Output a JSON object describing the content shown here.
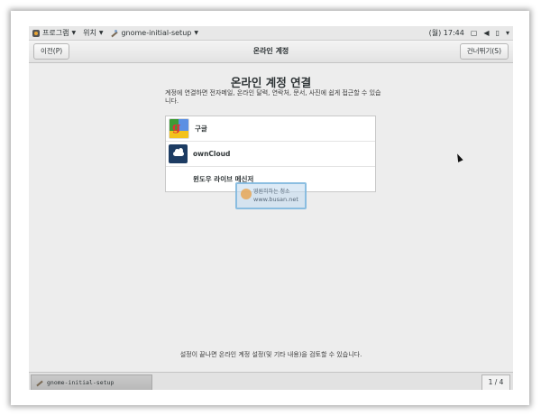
{
  "top_panel": {
    "applications_label": "프로그램",
    "places_label": "위치",
    "app_menu_label": "gnome-initial-setup",
    "clock": "(월) 17:44",
    "icons": [
      "applications-foot-icon",
      "chevron-down-icon",
      "display-icon",
      "volume-icon",
      "battery-icon",
      "power-icon"
    ]
  },
  "header_bar": {
    "back_label": "이전(P)",
    "title": "온라인 계정",
    "skip_label": "건너뛰기(S)"
  },
  "content": {
    "title": "온라인 계정 연결",
    "description": "계정에 연결하면 전자메일, 온라인 달력, 연락처, 문서, 사진에 쉽게 접근할 수 있습니다.",
    "accounts": [
      {
        "name": "구글",
        "icon": "google-logo-icon"
      },
      {
        "name": "ownCloud",
        "icon": "owncloud-logo-icon"
      },
      {
        "name": "윈도우 라이브 메신저",
        "icon": ""
      }
    ],
    "footer_note": "설정이 끝나면 온라인 계정 설정(및 기타 내용)을 검토할 수 있습니다."
  },
  "watermark": {
    "line1": "영원히하는 청소",
    "line2": "www.busan.net"
  },
  "bottom_panel": {
    "task_label": "gnome-initial-setup",
    "workspace": "1 / 4"
  },
  "colors": {
    "panel_bg": "#e8e8e8",
    "screen_bg": "#ededed",
    "list_bg": "#ffffff",
    "google_green": "#3d9b35",
    "google_blue": "#5b8fe3",
    "google_yellow": "#f3c21b",
    "owncloud_bg": "#1d3c63"
  }
}
